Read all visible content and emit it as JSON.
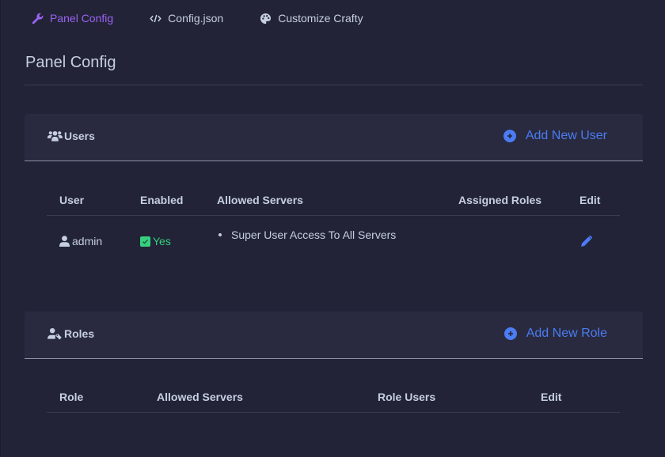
{
  "nav": {
    "tabs": [
      {
        "label": "Panel Config",
        "icon": "wrench-icon",
        "active": true
      },
      {
        "label": "Config.json",
        "icon": "code-icon",
        "active": false
      },
      {
        "label": "Customize Crafty",
        "icon": "palette-icon",
        "active": false
      }
    ]
  },
  "page": {
    "title": "Panel Config"
  },
  "users": {
    "title": "Users",
    "add_label": "Add New User",
    "columns": [
      "User",
      "Enabled",
      "Allowed Servers",
      "Assigned Roles",
      "Edit"
    ],
    "rows": [
      {
        "user": "admin",
        "enabled": "Yes",
        "allowed_servers": [
          "Super User Access To All Servers"
        ],
        "assigned_roles": ""
      }
    ]
  },
  "roles": {
    "title": "Roles",
    "add_label": "Add New Role",
    "columns": [
      "Role",
      "Allowed Servers",
      "Role Users",
      "Edit"
    ],
    "rows": []
  },
  "colors": {
    "accent_purple": "#9b63f0",
    "link_blue": "#4b7cf3",
    "enabled_green": "#36d07e",
    "background": "#222337",
    "card_header": "#292a3f"
  }
}
